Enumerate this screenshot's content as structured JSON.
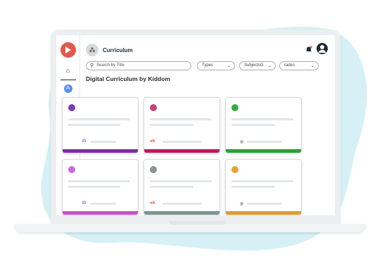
{
  "header": {
    "breadcrumb": "Curriculum",
    "page_title": "Digital Curriculum by Kiddom"
  },
  "filters": {
    "search_placeholder": "Search by Title",
    "types_label": "Types",
    "subjects_label": "SubjectsG",
    "grades_label": "rades"
  },
  "cards": [
    {
      "icon_color": "#7b3fb0",
      "bar_color": "#7b2fa8",
      "icon": "book-icon",
      "publisher_color": "#6a4bbd"
    },
    {
      "icon_color": "#c2447a",
      "bar_color": "#c2185b",
      "icon": "monitor-icon",
      "publisher_color": "#e05a4e"
    },
    {
      "icon_color": "#3aa84a",
      "bar_color": "#2e9d3a",
      "icon": "globe-icon",
      "publisher_color": "#9aa3ad"
    },
    {
      "icon_color": "#c86bd8",
      "bar_color": "#cc4fcf",
      "icon": "planet-icon",
      "publisher_color": "#6a4bbd"
    },
    {
      "icon_color": "#8a9494",
      "bar_color": "#7f9493",
      "icon": "microscope-icon",
      "publisher_color": "#e05a4e"
    },
    {
      "icon_color": "#e8a23a",
      "bar_color": "#e29a2c",
      "icon": "chat-icon",
      "publisher_color": "#9aa3ad"
    }
  ],
  "colors": {
    "brand": "#e05a4e",
    "backdrop": "#d6f0f6",
    "text": "#1f2a33"
  }
}
